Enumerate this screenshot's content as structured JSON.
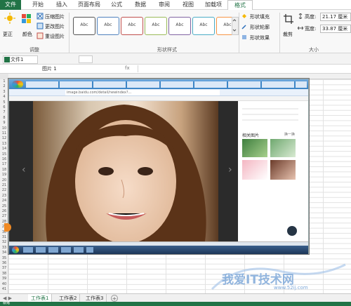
{
  "ribbon": {
    "tabs": [
      "文件",
      "开始",
      "插入",
      "页面布局",
      "公式",
      "数据",
      "审阅",
      "视图",
      "加载项",
      "格式"
    ],
    "active_tab": "格式",
    "adjust": {
      "correct": "更正",
      "color": "颜色",
      "compress": "压缩图片",
      "change": "更改图片",
      "reset": "重设图片",
      "group": "调整"
    },
    "styles": {
      "items": [
        "Abc",
        "Abc",
        "Abc",
        "Abc",
        "Abc",
        "Abc",
        "Abc"
      ],
      "group": "形状样式"
    },
    "shape": {
      "fill": "形状填充",
      "outline": "形状轮廓",
      "effect": "形状效果"
    },
    "size": {
      "crop": "裁剪",
      "height_label": "高度:",
      "height_value": "21.17 厘米",
      "width_label": "宽度:",
      "width_value": "33.87 厘米",
      "group": "大小"
    }
  },
  "workbook": {
    "doc_tab": "文件1"
  },
  "formula": {
    "name_box": "图片 1",
    "fx": "fx"
  },
  "screenshot": {
    "address": "image.baidu.com/detail/newindex?...",
    "sidebar_title": "相关图片",
    "sidebar_more": "换一换"
  },
  "sheets": [
    "工作表1",
    "工作表2",
    "工作表3"
  ],
  "status": {
    "ready": "就绪"
  },
  "watermark": {
    "text": "我爱IT技术网",
    "url": "www.52ij.com"
  },
  "colors": {
    "accent": "#217346"
  }
}
